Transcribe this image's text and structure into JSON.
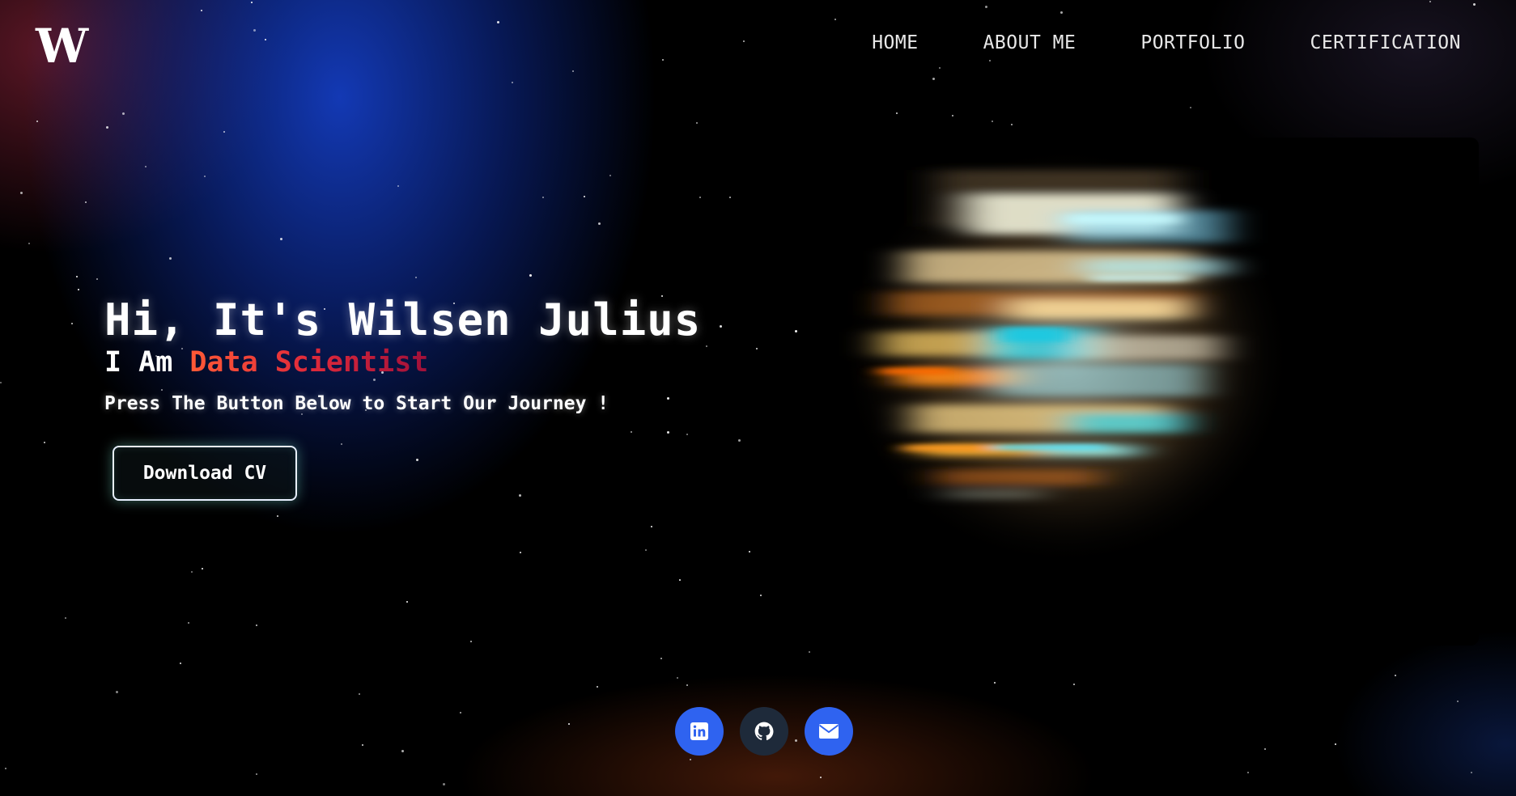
{
  "header": {
    "logo_text": "W",
    "nav": [
      "HOME",
      "ABOUT ME",
      "PORTFOLIO",
      "CERTIFICATION"
    ]
  },
  "hero": {
    "title": "Hi, It's Wilsen Julius",
    "role_prefix": "I Am ",
    "role_highlight": "Data Scientist",
    "subtitle": "Press The Button Below to Start Our Journey !",
    "cv_button_label": "Download CV"
  },
  "social": {
    "items": [
      "linkedin-icon",
      "github-icon",
      "email-icon"
    ]
  },
  "colors": {
    "accent_blue": "#2f63f0",
    "role_gradient_start": "#ff5a36",
    "role_gradient_end": "#a0103a",
    "background": "#000000"
  }
}
